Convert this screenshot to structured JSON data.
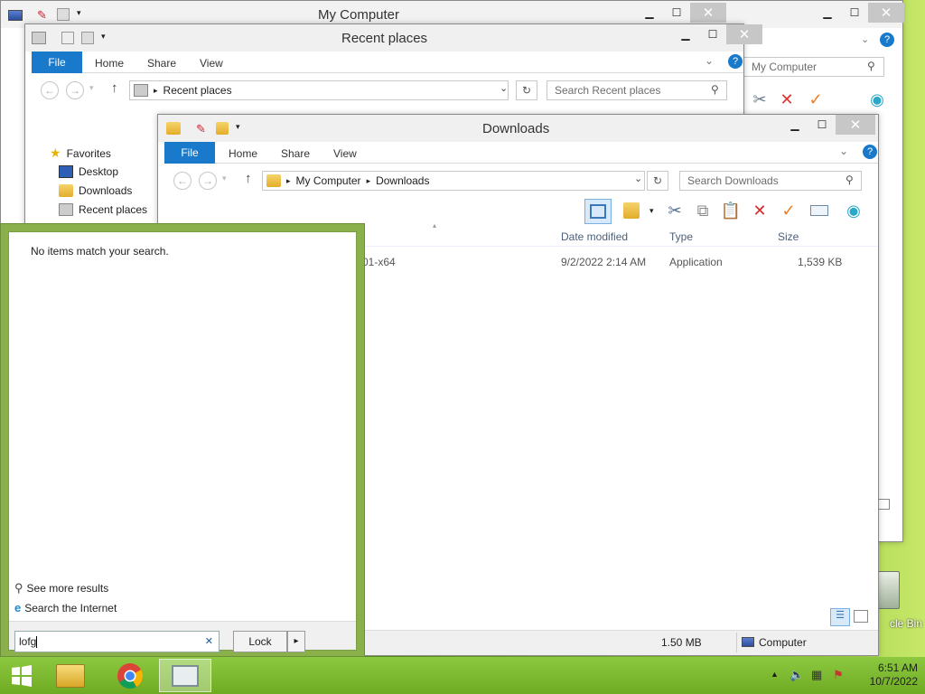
{
  "desktop": {
    "recycle_bin_label": "cle Bin"
  },
  "win_my_computer": {
    "title": "My Computer",
    "search_placeholder": "My Computer",
    "min": "▁",
    "max": "☐",
    "close": "✕",
    "close2": "✕"
  },
  "win_recent": {
    "title": "Recent places",
    "tabs": {
      "file": "File",
      "home": "Home",
      "share": "Share",
      "view": "View"
    },
    "address": "Recent places",
    "search_placeholder": "Search Recent places",
    "nav": {
      "favorites": "Favorites",
      "desktop": "Desktop",
      "downloads": "Downloads",
      "recent": "Recent places"
    }
  },
  "win_downloads": {
    "title": "Downloads",
    "tabs": {
      "file": "File",
      "home": "Home",
      "share": "Share",
      "view": "View"
    },
    "address": {
      "root": "My Computer",
      "leaf": "Downloads"
    },
    "search_placeholder": "Search Downloads",
    "columns": {
      "modified": "Date modified",
      "type": "Type",
      "size": "Size"
    },
    "rows": [
      {
        "name": "01-x64",
        "modified": "9/2/2022 2:14 AM",
        "type": "Application",
        "size": "1,539 KB"
      }
    ],
    "status": {
      "size": "1.50 MB",
      "location": "Computer"
    }
  },
  "start_search": {
    "no_items": "No items match your search.",
    "see_more": "See more results",
    "search_internet": "Search the Internet",
    "query": "lofg",
    "clear": "✕",
    "lock_label": "Lock",
    "lock_arrow": "▸"
  },
  "taskbar": {
    "clock_time": "6:51 AM",
    "clock_date": "10/7/2022",
    "tray_arrow": "▲"
  },
  "colors": {
    "accent": "#1979ca",
    "taskbar": "#7db832",
    "start_panel": "#89b04a"
  }
}
